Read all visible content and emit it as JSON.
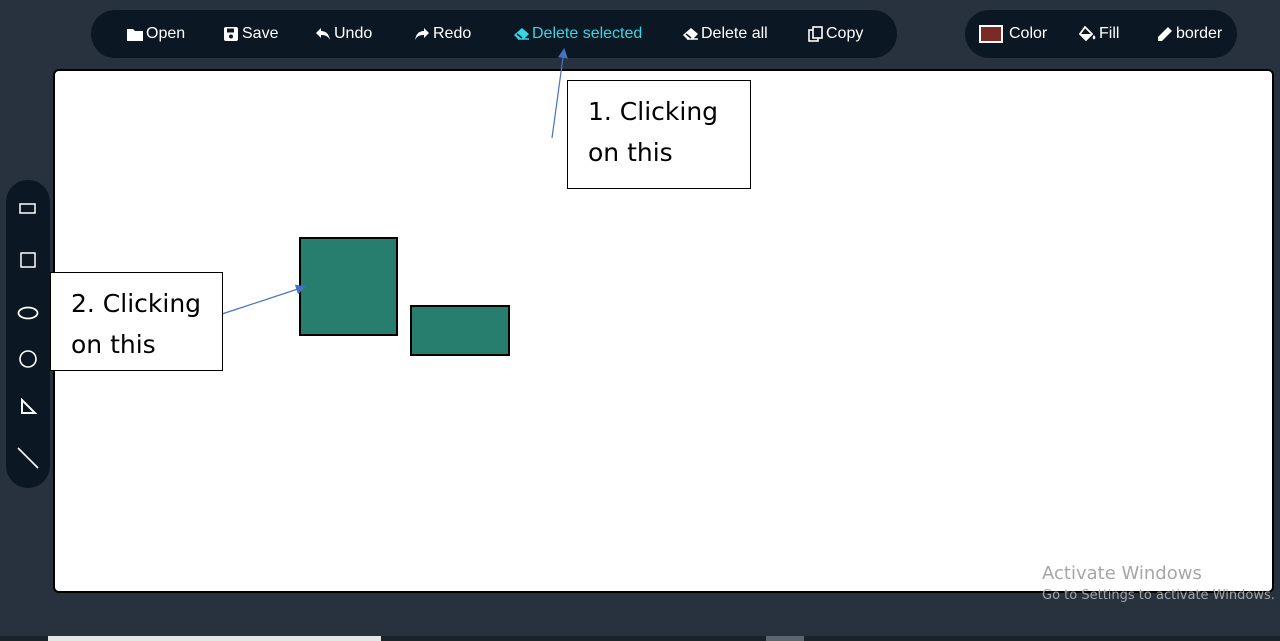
{
  "toolbar": {
    "open": "Open",
    "save": "Save",
    "undo": "Undo",
    "redo": "Redo",
    "delete_selected": "Delete selected",
    "delete_all": "Delete all",
    "copy": "Copy"
  },
  "style_toolbar": {
    "color": "Color",
    "fill": "Fill",
    "border": "border",
    "current_color": "#7a2b24"
  },
  "palette": {
    "items": [
      "rectangle-icon",
      "square-icon",
      "ellipse-icon",
      "circle-icon",
      "triangle-icon",
      "line-icon"
    ]
  },
  "canvas": {
    "shape_fill": "#287e6e",
    "shape_border": "#000000"
  },
  "annotations": {
    "callout1_line1": "1. Clicking",
    "callout1_line2": "on this",
    "callout2_line1": "2. Clicking",
    "callout2_line2": "on this",
    "arrow_color": "#4472c4"
  },
  "watermark": {
    "line1": "Activate Windows",
    "line2": "Go to Settings to activate Windows."
  },
  "colors": {
    "background": "#27323e",
    "toolbar": "#0b1722",
    "active": "#36d6e3"
  }
}
